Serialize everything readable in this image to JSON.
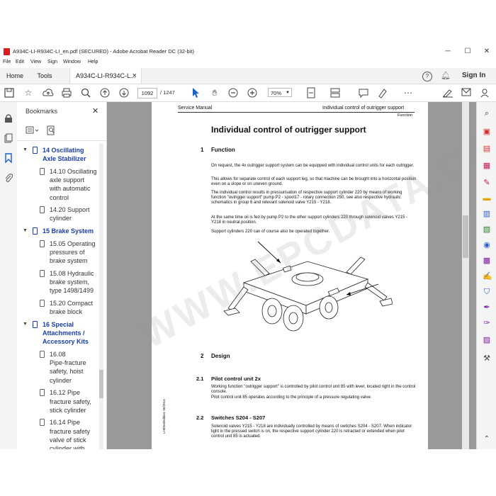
{
  "window": {
    "title": "A934C-LI-R934C-LI_en.pdf (SECURED) - Adobe Acrobat Reader DC (32-bit)",
    "minimize": "─",
    "maximize": "☐",
    "close": "✕"
  },
  "menu": [
    "File",
    "Edit",
    "View",
    "Sign",
    "Window",
    "Help"
  ],
  "tabs": {
    "home": "Home",
    "tools": "Tools",
    "document": "A934C-LI-R934C-L...",
    "document_close": "×",
    "sign_in": "Sign In"
  },
  "toolbar": {
    "current_page": "1092",
    "total_pages": "/ 1247",
    "zoom": "70%"
  },
  "bookmarks": {
    "title": "Bookmarks",
    "close": "✕",
    "items": [
      {
        "label": "14 Oscillating Axle Stabilizer",
        "lines": [
          "14 Oscillating",
          "Axle Stabilizer"
        ],
        "chapter": true
      },
      {
        "label": "14.10 Oscillating axle support with automatic control",
        "lines": [
          "14.10 Oscillating",
          "axle support",
          "with automatic",
          "control"
        ],
        "chapter": false
      },
      {
        "label": "14.20 Support cylinder",
        "lines": [
          "14.20 Support",
          "cylinder"
        ],
        "chapter": false
      },
      {
        "label": "15 Brake System",
        "lines": [
          "15 Brake System"
        ],
        "chapter": true
      },
      {
        "label": "15.05 Operating pressures of brake system",
        "lines": [
          "15.05 Operating",
          "pressures of",
          "brake system"
        ],
        "chapter": false
      },
      {
        "label": "15.08 Hydraulic brake system, type 1498/1499",
        "lines": [
          "15.08 Hydraulic",
          "brake system,",
          "type 1498/1499"
        ],
        "chapter": false
      },
      {
        "label": "15.20 Compact brake block",
        "lines": [
          "15.20 Compact",
          "brake block"
        ],
        "chapter": false
      },
      {
        "label": "16 Special Attachments / Accessory Kits",
        "lines": [
          "16 Special",
          "Attachments /",
          "Accessory Kits"
        ],
        "chapter": true
      },
      {
        "label": "16.08 Pipe-fracture safety, hoist cylinder",
        "lines": [
          "16.08",
          "Pipe-fracture",
          "safety, hoist",
          "cylinder"
        ],
        "chapter": false
      },
      {
        "label": "16.12 Pipe fracture safety, stick cylinder",
        "lines": [
          "16.12 Pipe",
          "fracture safety,",
          "stick cylinder"
        ],
        "chapter": false
      },
      {
        "label": "16.14 Pipe fracture safety valve of stick cylinder with double check",
        "lines": [
          "16.14 Pipe",
          "fracture safety",
          "valve of stick",
          "cylinder with",
          "double check"
        ],
        "chapter": false
      }
    ]
  },
  "document": {
    "header_left": "Service Manual",
    "header_right": "Individual control of outrigger support",
    "header_sub": "Function",
    "title": "Individual control of outrigger support",
    "s1_num": "1",
    "s1_title": "Function",
    "p1": "On request, the 4x outrigger support system can be equipped with individual control units for each outrigger.",
    "p2": "This allows for separate control of each support leg, so that machine can be brought into a horizontal position even on a slope or on uneven ground.",
    "p3": "The individual control results in pressurisation of respective support cylinder 220 by means of working function \"outrigger support\" pump P2 - spool17 - rotary connection 250, see also respective hydraulic schematics in group 6 and relevant solenoid valve Y215 - Y218.",
    "p4": "At the same time oil is fed by pump P2 to the other support cylinders 220 through solenoid valves Y215 - Y218 in neutral position.",
    "p5": "Support cylinders 220 can of course also be operated together.",
    "s2_num": "2",
    "s2_title": "Design",
    "s21_num": "2.1",
    "s21_title": "Pilot control unit 2x",
    "p6": "Working function \"outrigger support\" is controlled by pilot control unit 85 with lever, located right in the control console.",
    "p7": "Pilot control unit 85 operates according to the principle of a pressure regulating valve.",
    "s22_num": "2.2",
    "s22_title": "Switches S204 - S207",
    "p8": "Solenoid valves Y215 - Y218 are individually controlled by means of switches S204 - S207. When indicator light in the pressed switch is on, the respective support cylinder 220 is retracted or extended when pilot control unit 85 is actuated.",
    "margin_note": "LHB/en/Edition: 06/2014"
  },
  "watermark": "WWW.EPCDATA.COM",
  "colors": {
    "accent": "#1a3da6",
    "doc_bg": "#999999",
    "acrobat_red": "#d71d1d"
  }
}
